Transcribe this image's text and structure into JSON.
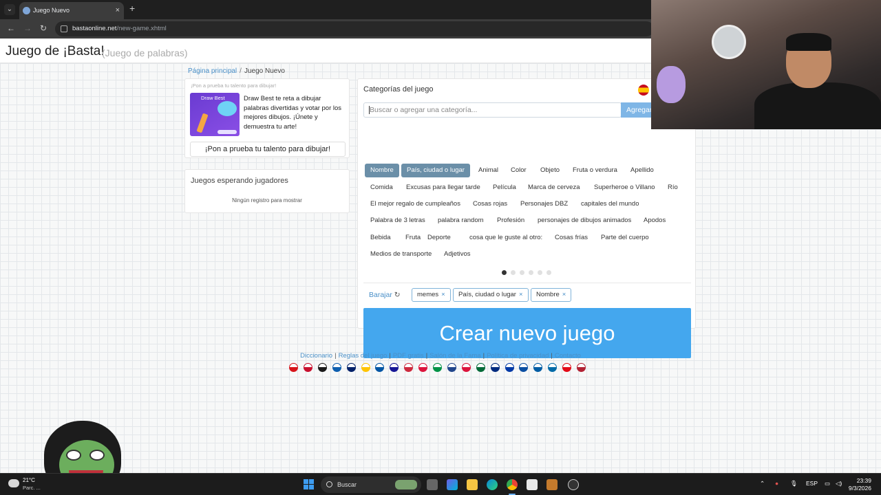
{
  "browser": {
    "tab_title": "Juego Nuevo",
    "url_domain": "bastaonline.net",
    "url_path": "/new-game.xhtml"
  },
  "site": {
    "title": "Juego de ¡Basta!",
    "subtitle": "(Juego de palabras)"
  },
  "breadcrumb": {
    "home": "Página principal",
    "separator": "/",
    "current": "Juego Nuevo"
  },
  "promo": {
    "heading": "¡Pon a prueba tu talento para dibujar!",
    "image_title": "Draw Best",
    "text": "Draw Best te reta a dibujar palabras divertidas y votar por los mejores dibujos. ¡Únete y demuestra tu arte!",
    "button": "¡Pon a prueba tu talento para dibujar!"
  },
  "waiting": {
    "title": "Juegos esperando jugadores",
    "empty": "Ningún registro para mostrar"
  },
  "categories": {
    "title": "Categorías del juego",
    "search_placeholder": "Buscar o agregar una categoría...",
    "add_button": "Agregar",
    "rows": [
      [
        {
          "label": "Nombre",
          "selected": true
        },
        {
          "label": "País, ciudad o lugar",
          "selected": true
        },
        {
          "label": "Animal"
        },
        {
          "label": "Color"
        },
        {
          "label": "Objeto"
        },
        {
          "label": "Fruta o verdura"
        },
        {
          "label": "Apellido"
        }
      ],
      [
        {
          "label": "Comida"
        },
        {
          "label": "Excusas para llegar tarde"
        },
        {
          "label": "Película"
        },
        {
          "label": "Marca de cerveza"
        },
        {
          "label": "Superheroe o Villano"
        },
        {
          "label": "Río"
        }
      ],
      [
        {
          "label": "El mejor regalo de cumpleaños"
        },
        {
          "label": "Cosas rojas"
        },
        {
          "label": "Personajes DBZ"
        },
        {
          "label": "capitales del mundo"
        }
      ],
      [
        {
          "label": "Palabra de 3 letras"
        },
        {
          "label": "palabra random"
        },
        {
          "label": "Profesión"
        },
        {
          "label": "personajes de dibujos animados"
        },
        {
          "label": "Apodos"
        }
      ],
      [
        {
          "label": "Bebida"
        },
        {
          "label": "Fruta"
        },
        {
          "label": "Deporte"
        },
        {
          "label": "cosa que le guste al otro:"
        },
        {
          "label": "Cosas frías"
        },
        {
          "label": "Parte del cuerpo"
        }
      ],
      [
        {
          "label": "Medios de transporte"
        },
        {
          "label": "Adjetivos"
        }
      ]
    ],
    "pages": 6,
    "current_page": 1,
    "shuffle": "Barajar",
    "selected_tags": [
      "memes",
      "País, ciudad o lugar",
      "Nombre"
    ],
    "create_button": "Crear nuevo juego"
  },
  "footer": {
    "links": [
      "Diccionario",
      "Reglas del juego",
      "PDF gratis",
      "Salón de la Fama",
      "Política de privacidad",
      "Contacto"
    ],
    "separator": "|",
    "flag_colors": [
      "#d7141a",
      "#c8102e",
      "#1a1a1a",
      "#0d5eaf",
      "#012169",
      "#ffc400",
      "#0055a4",
      "#171796",
      "#cd2a3e",
      "#dc143c",
      "#009246",
      "#21468b",
      "#dc143c",
      "#046a38",
      "#002b7f",
      "#0039a6",
      "#0b4ea2",
      "#005da4",
      "#006aa7",
      "#e30a17",
      "#b22234"
    ]
  },
  "taskbar": {
    "weather_temp": "21°C",
    "weather_desc": "Parc. ...",
    "search": "Buscar",
    "lang": "ESP",
    "time": "23:39",
    "date": "9/3/2026"
  }
}
